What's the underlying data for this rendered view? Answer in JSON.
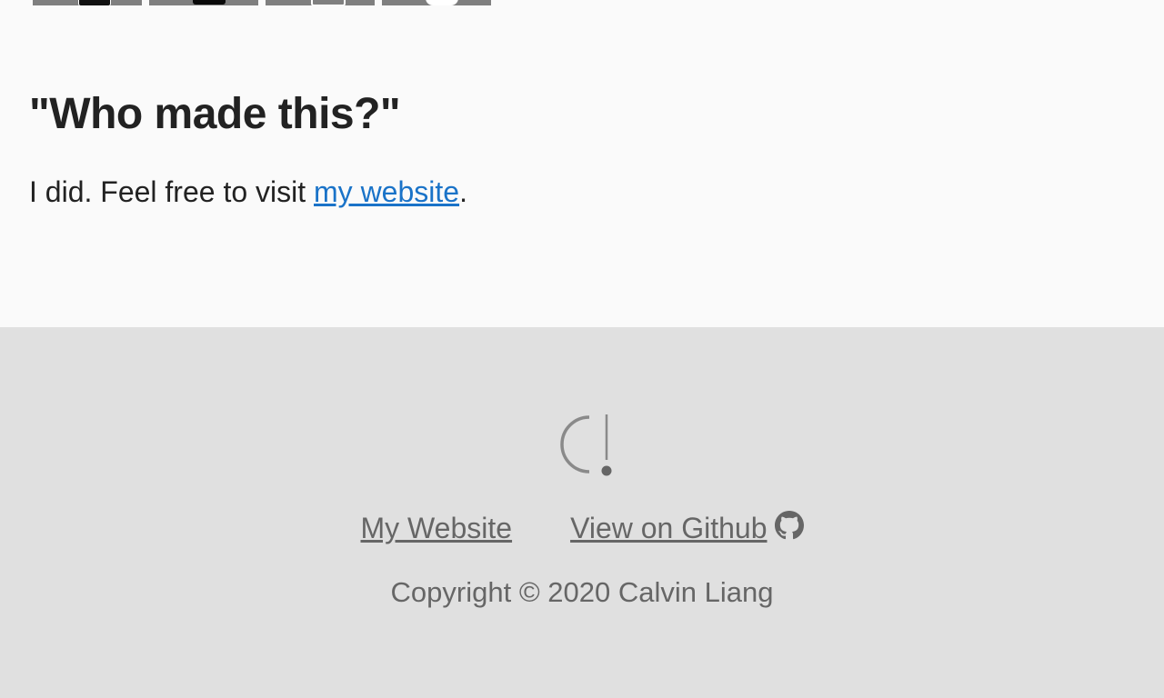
{
  "thumbnails": [
    {
      "id": "thumb-1"
    },
    {
      "id": "thumb-2"
    },
    {
      "id": "thumb-3"
    },
    {
      "id": "thumb-4"
    }
  ],
  "section": {
    "title": "\"Who made this?\"",
    "text_before": "I did. Feel free to visit ",
    "link_label": "my website",
    "text_after": "."
  },
  "footer": {
    "links": {
      "website": "My Website",
      "github": "View on Github "
    },
    "copyright": "Copyright © 2020 Calvin Liang",
    "icons": {
      "logo": "c-exclamation-logo-icon",
      "github": "github-icon"
    }
  },
  "colors": {
    "link": "#1a73c8",
    "footer_bg": "#e0e0e0",
    "page_bg": "#fafafa",
    "footer_text": "#666666"
  }
}
